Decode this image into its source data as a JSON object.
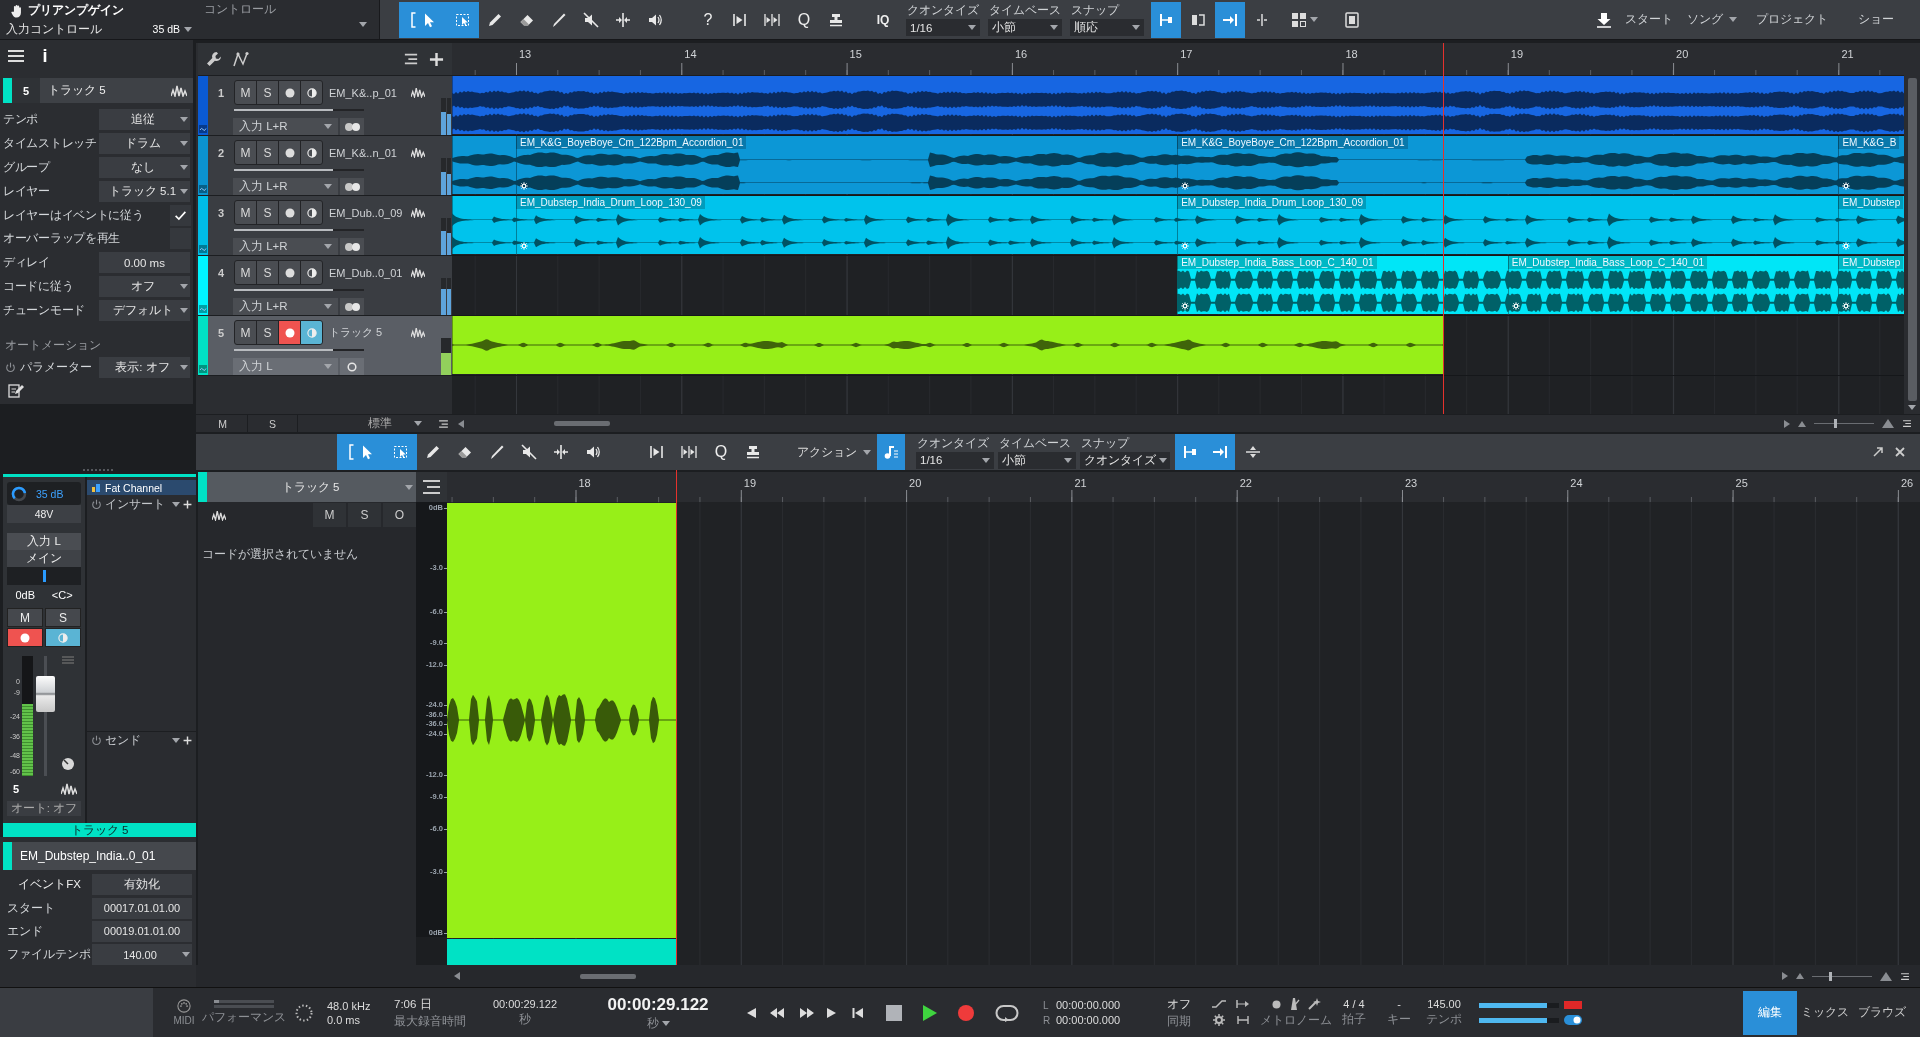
{
  "top_toolbar": {
    "preamp": {
      "title": "プリアンプゲイン",
      "subtitle": "入力コントロール",
      "value": "35 dB"
    },
    "control_label": "コントロール",
    "tools": [
      {
        "kind": "arrow",
        "selected": true
      },
      {
        "kind": "range",
        "selected": true
      },
      {
        "kind": "pencil",
        "selected": false
      },
      {
        "kind": "eraser",
        "selected": false
      },
      {
        "kind": "paint",
        "selected": false
      },
      {
        "kind": "mute",
        "selected": false
      },
      {
        "kind": "split",
        "selected": false
      },
      {
        "kind": "listen",
        "selected": false
      }
    ],
    "actions": [
      {
        "kind": "help",
        "label": "?"
      },
      {
        "kind": "stretch"
      },
      {
        "kind": "slice"
      },
      {
        "kind": "quantize",
        "label": "Q"
      },
      {
        "kind": "strip"
      }
    ],
    "iq_label": "IQ",
    "fields": [
      {
        "label": "クオンタイズ",
        "value": "1/16"
      },
      {
        "label": "タイムベース",
        "value": "小節"
      },
      {
        "label": "スナップ",
        "value": "順応"
      }
    ],
    "snap_buttons": [
      {
        "kind": "line",
        "selected": true
      },
      {
        "kind": "cursor",
        "selected": false
      },
      {
        "kind": "grid",
        "selected": true
      },
      {
        "kind": "event",
        "selected": false
      }
    ],
    "pages": [
      {
        "label": "スタート",
        "dropdown": false
      },
      {
        "label": "ソング",
        "dropdown": true
      },
      {
        "label": "プロジェクト",
        "dropdown": false
      },
      {
        "label": "ショー",
        "dropdown": false
      }
    ]
  },
  "inspector": {
    "info": "i",
    "track": {
      "number": "5",
      "name": "トラック 5",
      "color": "#00e2c5"
    },
    "rows": [
      {
        "kind": "dropdown",
        "label": "テンポ",
        "value": "追従"
      },
      {
        "kind": "dropdown",
        "label": "タイムストレッチ",
        "value": "ドラム"
      },
      {
        "kind": "dropdown",
        "label": "グループ",
        "value": "なし"
      },
      {
        "kind": "dropdown",
        "label": "レイヤー",
        "value": "トラック 5.1"
      },
      {
        "kind": "checkbox",
        "label": "レイヤーはイベントに従う",
        "checked": true
      },
      {
        "kind": "checkbox",
        "label": "オーバーラップを再生",
        "checked": false
      },
      {
        "kind": "value",
        "label": "ディレイ",
        "value": "0.00 ms"
      },
      {
        "kind": "dropdown",
        "label": "コードに従う",
        "value": "オフ"
      },
      {
        "kind": "dropdown",
        "label": "チューンモード",
        "value": "デフォルト"
      }
    ],
    "automation": {
      "heading": "オートメーション",
      "label": "パラメーター",
      "value": "表示: オフ"
    }
  },
  "channel": {
    "color": "#00e2c5",
    "gain": "35 dB",
    "phantom": "48V",
    "input": "入力 L",
    "output": "メイン",
    "pan": {
      "level": 0.5
    },
    "volume_readout": "0dB",
    "pan_readout": "<C>",
    "buttons": [
      {
        "kind": "mute",
        "label": "M",
        "on": false
      },
      {
        "kind": "solo",
        "label": "S",
        "on": false
      },
      {
        "kind": "record",
        "on": true
      },
      {
        "kind": "monitor",
        "on": true
      }
    ],
    "scale": [
      "0",
      "-9",
      "-24",
      "-36",
      "-48",
      "-60"
    ],
    "meter": {
      "level": 0.6
    },
    "fader": {
      "level": 0.76
    },
    "number": "5",
    "automation": "オート: オフ",
    "inserts": {
      "plugin": "Fat Channel",
      "heading": "インサート"
    },
    "sends": {
      "heading": "センド"
    },
    "name": "トラック 5"
  },
  "event": {
    "name": "EM_Dubstep_India..0_01",
    "color": "#00e2c5",
    "rows": [
      {
        "kind": "button",
        "label": "イベントFX",
        "value": "有効化"
      },
      {
        "kind": "value",
        "label": "スタート",
        "value": "00017.01.01.00"
      },
      {
        "kind": "value",
        "label": "エンド",
        "value": "00019.01.01.00"
      },
      {
        "kind": "dropdown",
        "label": "ファイルテンポ",
        "value": "140.00"
      }
    ]
  },
  "arrange": {
    "ruler": [
      "13",
      "14",
      "15",
      "16",
      "17",
      "18",
      "19",
      "20",
      "21"
    ],
    "tracks": [
      {
        "number": "1",
        "name": "EM_K&..p_01",
        "color": "#0a5ad4",
        "selected": false,
        "buttons": [
          {
            "kind": "mute",
            "label": "M",
            "on": false
          },
          {
            "kind": "solo",
            "label": "S",
            "on": false
          },
          {
            "kind": "record",
            "on": false
          },
          {
            "kind": "monitor",
            "on": false
          }
        ],
        "level": 0.76,
        "input": "入力 L+R",
        "stereo": true,
        "meters": [
          {
            "level": 0.61,
            "color": "#5ea4dc"
          },
          {
            "level": 0.57,
            "color": "#5ea4dc"
          }
        ],
        "clips": [
          {
            "color": "#1766e2"
          }
        ]
      },
      {
        "number": "2",
        "name": "EM_K&..n_01",
        "color": "#0b93d0",
        "selected": false,
        "buttons": [
          {
            "kind": "mute",
            "label": "M",
            "on": false
          },
          {
            "kind": "solo",
            "label": "S",
            "on": false
          },
          {
            "kind": "record",
            "on": false
          },
          {
            "kind": "monitor",
            "on": false
          }
        ],
        "level": 0.76,
        "input": "入力 L+R",
        "stereo": true,
        "meters": [
          {
            "level": 0.61,
            "color": "#5ea4dc"
          },
          {
            "level": 0.57,
            "color": "#5ea4dc"
          }
        ],
        "clips": [
          {
            "color": "#0c97d6"
          },
          {
            "name": "EM_K&G_BoyeBoye_Cm_122Bpm_Accordion_01",
            "color": "#0c97d6"
          },
          {
            "name": "EM_K&G_BoyeBoye_Cm_122Bpm_Accordion_01",
            "color": "#0c97d6"
          },
          {
            "name": "EM_K&G_B",
            "color": "#0c97d6"
          }
        ]
      },
      {
        "number": "3",
        "name": "EM_Dub..0_09",
        "color": "#00bce6",
        "selected": false,
        "buttons": [
          {
            "kind": "mute",
            "label": "M",
            "on": false
          },
          {
            "kind": "solo",
            "label": "S",
            "on": false
          },
          {
            "kind": "record",
            "on": false
          },
          {
            "kind": "monitor",
            "on": false
          }
        ],
        "level": 0.76,
        "input": "入力 L+R",
        "stereo": true,
        "meters": [
          {
            "level": 0.66,
            "color": "#5ea4dc"
          },
          {
            "level": 0.6,
            "color": "#5ea4dc"
          }
        ],
        "clips": [
          {
            "color": "#00c3ec"
          },
          {
            "name": "EM_Dubstep_India_Drum_Loop_130_09",
            "color": "#00c3ec"
          },
          {
            "name": "EM_Dubstep_India_Drum_Loop_130_09",
            "color": "#00c3ec"
          },
          {
            "name": "EM_Dubstep",
            "color": "#00c3ec"
          }
        ]
      },
      {
        "number": "4",
        "name": "EM_Dub..0_01",
        "color": "#00f4ff",
        "selected": false,
        "buttons": [
          {
            "kind": "mute",
            "label": "M",
            "on": false
          },
          {
            "kind": "solo",
            "label": "S",
            "on": false
          },
          {
            "kind": "record",
            "on": false
          },
          {
            "kind": "monitor",
            "on": false
          }
        ],
        "level": 0.76,
        "input": "入力 L+R",
        "stereo": true,
        "meters": [
          {
            "level": 0.71,
            "color": "#5ea4dc"
          },
          {
            "level": 0.69,
            "color": "#5ea4dc"
          }
        ],
        "clips": [
          {
            "name": "EM_Dubstep_India_Bass_Loop_C_140_01",
            "color": "#00e6f7"
          },
          {
            "name": "EM_Dubstep_India_Bass_Loop_C_140_01",
            "color": "#00e6f7"
          },
          {
            "name": "EM_Dubstep",
            "color": "#00e6f7"
          }
        ]
      },
      {
        "number": "5",
        "name": "トラック 5",
        "color": "#00e2c5",
        "selected": true,
        "buttons": [
          {
            "kind": "mute",
            "label": "M",
            "on": false
          },
          {
            "kind": "solo",
            "label": "S",
            "on": false
          },
          {
            "kind": "record",
            "on": true
          },
          {
            "kind": "monitor",
            "on": true
          }
        ],
        "level": 0.76,
        "input": "入力 L",
        "stereo": false,
        "meters": [
          {
            "level": 0.6,
            "color": "#92d05c"
          }
        ],
        "clips": [
          {
            "color": "#97ef18"
          }
        ]
      }
    ],
    "footer": {
      "buttons": [
        {
          "label": "M"
        },
        {
          "label": "S"
        }
      ],
      "layout": "標準",
      "zoom": {
        "level": 0.35
      }
    }
  },
  "editor": {
    "toolbar": {
      "tools": [
        {
          "kind": "arrow",
          "selected": true
        },
        {
          "kind": "range",
          "selected": true
        },
        {
          "kind": "pencil",
          "selected": false
        },
        {
          "kind": "eraser",
          "selected": false
        },
        {
          "kind": "paint",
          "selected": false
        },
        {
          "kind": "mute",
          "selected": false
        },
        {
          "kind": "split",
          "selected": false
        },
        {
          "kind": "listen",
          "selected": false
        }
      ],
      "actions": [
        {
          "kind": "stretch"
        },
        {
          "kind": "slice"
        },
        {
          "kind": "quantize",
          "label": "Q"
        },
        {
          "kind": "strip"
        }
      ],
      "action_menu": "アクション",
      "quantize_button": {
        "selected": true
      },
      "fields": [
        {
          "label": "クオンタイズ",
          "value": "1/16"
        },
        {
          "label": "タイムベース",
          "value": "小節"
        },
        {
          "label": "スナップ",
          "value": "クオンタイズ"
        }
      ],
      "snap_buttons": [
        {
          "kind": "line",
          "selected": true
        },
        {
          "kind": "grid",
          "selected": true
        }
      ]
    },
    "track": {
      "name": "トラック 5",
      "color": "#00e2c5"
    },
    "buttons": [
      {
        "label": "M"
      },
      {
        "label": "S"
      },
      {
        "label": "O"
      }
    ],
    "chord_message": "コードが選択されていません",
    "ruler": [
      "18",
      "19",
      "20",
      "21",
      "22",
      "23",
      "24",
      "25",
      "26"
    ],
    "db_scale": [
      "0dB",
      "-3.0",
      "-6.0",
      "-9.0",
      "-12.0",
      "-24.0",
      "-36.0",
      "-36.0",
      "-24.0",
      "-12.0",
      "-9.0",
      "-6.0",
      "-3.0",
      "0dB"
    ],
    "event": {
      "color": "#97ef18"
    },
    "footer": {
      "zoom": {
        "level": 0.3
      }
    }
  },
  "transport": {
    "midi_label": "MIDI",
    "performance_label": "パフォーマンス",
    "sample_rate": "48.0 kHz",
    "latency": "0.0 ms",
    "record_time": "7:06 日",
    "record_time_label": "最大録音時間",
    "secondary_time": "00:00:29.122",
    "secondary_unit": "秒",
    "primary_time": "00:00:29.122",
    "primary_unit": "秒",
    "playing": true,
    "loop": false,
    "loop_start_label": "L",
    "loop_start": "00:00:00.000",
    "loop_end_label": "R",
    "loop_end": "00:00:00.000",
    "sync": "オフ",
    "sync_label": "同期",
    "metronome_label": "メトロノーム",
    "signature": "4 / 4",
    "signature_label": "拍子",
    "key": "-",
    "key_label": "キー",
    "tempo": "145.00",
    "tempo_label": "テンポ",
    "meters": [
      {
        "level": 0.85,
        "clip": true
      },
      {
        "level": 0.85
      }
    ],
    "monitor_toggle": {
      "on": true
    },
    "pages": [
      {
        "label": "編集",
        "selected": true
      },
      {
        "label": "ミックス",
        "selected": false
      },
      {
        "label": "ブラウズ",
        "selected": false
      }
    ]
  }
}
